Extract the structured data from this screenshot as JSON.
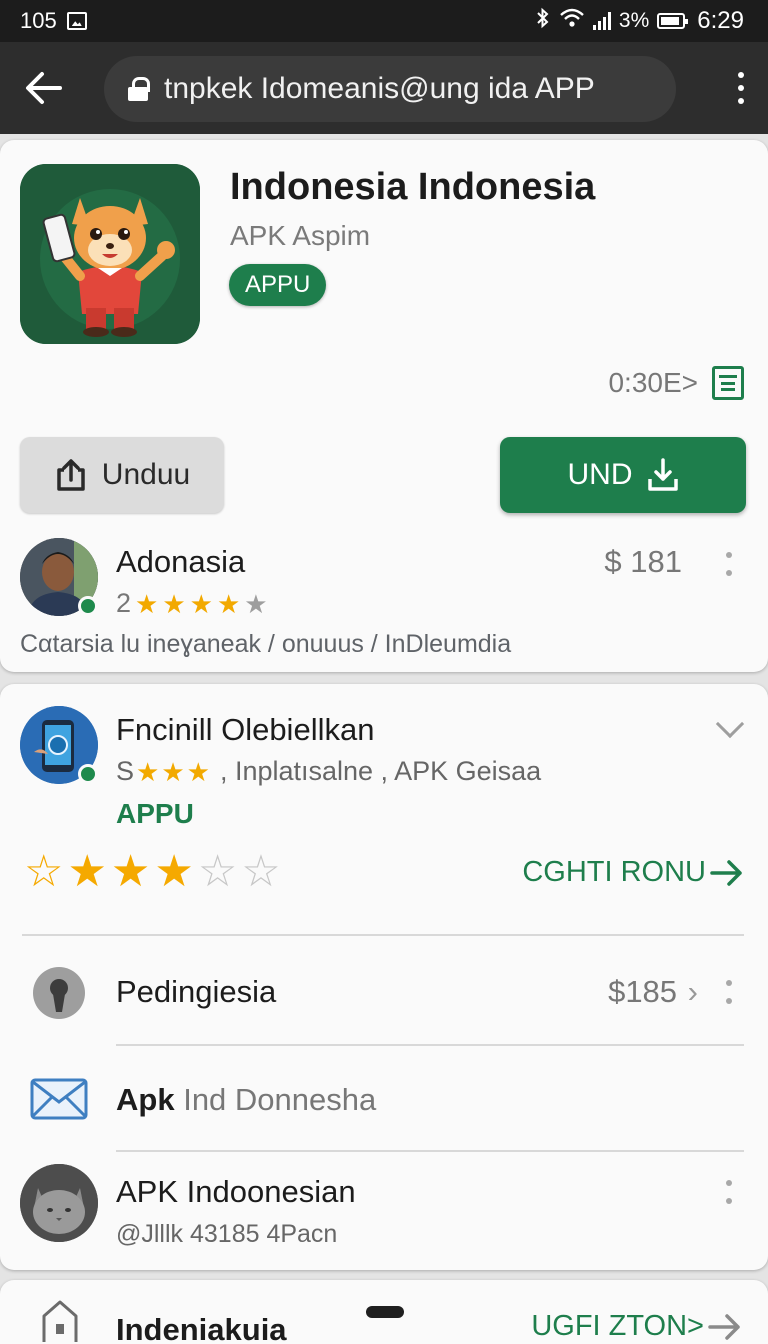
{
  "status_bar": {
    "left_text": "105",
    "battery_text": "3%",
    "time": "6:29"
  },
  "browser": {
    "url": "tnpkek Idomeanis@ung ida APP"
  },
  "app": {
    "title": "Indonesia Indonesia",
    "subtitle": "APK Aspim",
    "chip": "APPU",
    "size": "0:30E>",
    "button_secondary": "Unduu",
    "button_primary": "UND",
    "accent_color": "#1e7e4c"
  },
  "review": {
    "name": "Adonasia",
    "rating_number": "2",
    "stars": 4,
    "price": "$ 181",
    "path": "Cαtarsia lu ineɣaneak / onuuus / InDleumdia"
  },
  "listing": {
    "title": "Fncinill Olebiellkan",
    "rating_prefix": "S",
    "stars": 3,
    "meta": ", Inplatısalne , APK Geisaa",
    "chip": "APPU",
    "rating_display": 3.5,
    "link": "CGHTI RONU"
  },
  "rows": [
    {
      "label": "Pedingiesia",
      "value": "$185"
    },
    {
      "label_bold": "Apk",
      "label_light": "Ind Donnesha"
    },
    {
      "label": "APK Indoonesian",
      "sub": "@Jlllk 43185 4Pacn"
    }
  ],
  "bottom": {
    "label": "Indeniakuia",
    "link": "UGFI ZTON>"
  }
}
